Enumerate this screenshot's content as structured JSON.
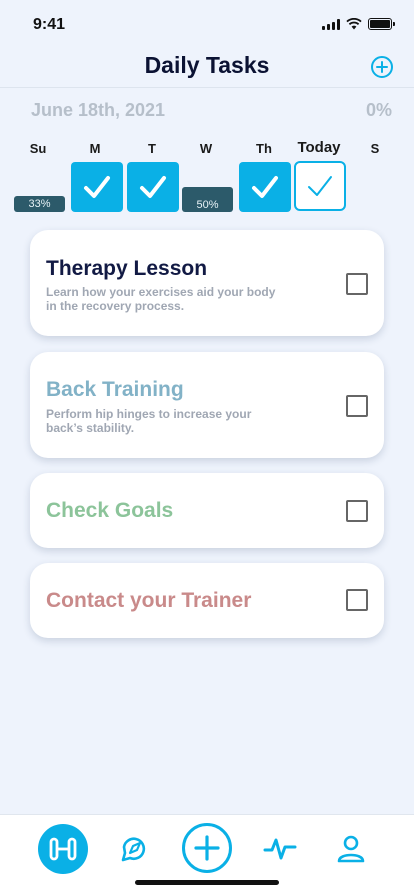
{
  "status": {
    "time": "9:41"
  },
  "header": {
    "title": "Daily Tasks",
    "add_icon": "plus-circle-icon"
  },
  "summary": {
    "date": "June 18th, 2021",
    "percent": "0%"
  },
  "week": {
    "days": [
      {
        "label": "Su",
        "state": "partial",
        "percent": "33%",
        "fraction": 0.33
      },
      {
        "label": "M",
        "state": "complete"
      },
      {
        "label": "T",
        "state": "complete"
      },
      {
        "label": "W",
        "state": "partial",
        "percent": "50%",
        "fraction": 0.5
      },
      {
        "label": "Th",
        "state": "complete"
      },
      {
        "label": "Today",
        "state": "today"
      },
      {
        "label": "S",
        "state": "none"
      }
    ]
  },
  "tasks": [
    {
      "title": "Therapy Lesson",
      "description": "Learn how your exercises aid your body in the recovery process.",
      "color": "#121a44",
      "checked": false
    },
    {
      "title": "Back Training",
      "description": "Perform hip hinges to increase your back’s stability.",
      "color": "#82b2c7",
      "checked": false
    },
    {
      "title": "Check Goals",
      "description": "",
      "color": "#8cc49a",
      "checked": false
    },
    {
      "title": "Contact your Trainer",
      "description": "",
      "color": "#c98a8a",
      "checked": false
    }
  ],
  "tabbar": {
    "items": [
      {
        "name": "workouts",
        "icon": "dumbbell-icon",
        "active": true
      },
      {
        "name": "explore",
        "icon": "compass-icon",
        "active": false
      },
      {
        "name": "add",
        "icon": "plus-circle-icon",
        "active": false
      },
      {
        "name": "activity",
        "icon": "pulse-icon",
        "active": false
      },
      {
        "name": "profile",
        "icon": "user-icon",
        "active": false
      }
    ]
  },
  "colors": {
    "accent": "#0ab0e6",
    "progress": "#2c5a6a",
    "background": "#eef3fc"
  }
}
